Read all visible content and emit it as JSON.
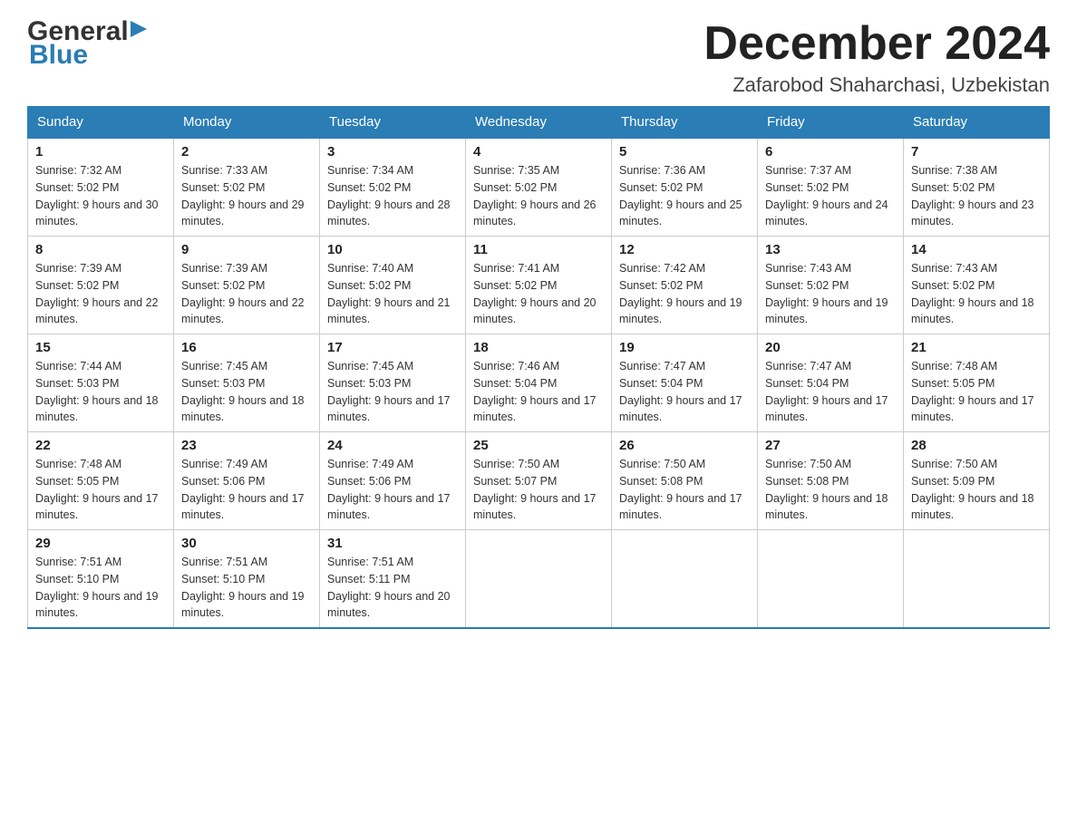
{
  "header": {
    "logo_general": "General",
    "logo_blue": "Blue",
    "month_title": "December 2024",
    "location": "Zafarobod Shaharchasi, Uzbekistan"
  },
  "days_of_week": [
    "Sunday",
    "Monday",
    "Tuesday",
    "Wednesday",
    "Thursday",
    "Friday",
    "Saturday"
  ],
  "weeks": [
    [
      {
        "day": "1",
        "sunrise": "7:32 AM",
        "sunset": "5:02 PM",
        "daylight": "9 hours and 30 minutes."
      },
      {
        "day": "2",
        "sunrise": "7:33 AM",
        "sunset": "5:02 PM",
        "daylight": "9 hours and 29 minutes."
      },
      {
        "day": "3",
        "sunrise": "7:34 AM",
        "sunset": "5:02 PM",
        "daylight": "9 hours and 28 minutes."
      },
      {
        "day": "4",
        "sunrise": "7:35 AM",
        "sunset": "5:02 PM",
        "daylight": "9 hours and 26 minutes."
      },
      {
        "day": "5",
        "sunrise": "7:36 AM",
        "sunset": "5:02 PM",
        "daylight": "9 hours and 25 minutes."
      },
      {
        "day": "6",
        "sunrise": "7:37 AM",
        "sunset": "5:02 PM",
        "daylight": "9 hours and 24 minutes."
      },
      {
        "day": "7",
        "sunrise": "7:38 AM",
        "sunset": "5:02 PM",
        "daylight": "9 hours and 23 minutes."
      }
    ],
    [
      {
        "day": "8",
        "sunrise": "7:39 AM",
        "sunset": "5:02 PM",
        "daylight": "9 hours and 22 minutes."
      },
      {
        "day": "9",
        "sunrise": "7:39 AM",
        "sunset": "5:02 PM",
        "daylight": "9 hours and 22 minutes."
      },
      {
        "day": "10",
        "sunrise": "7:40 AM",
        "sunset": "5:02 PM",
        "daylight": "9 hours and 21 minutes."
      },
      {
        "day": "11",
        "sunrise": "7:41 AM",
        "sunset": "5:02 PM",
        "daylight": "9 hours and 20 minutes."
      },
      {
        "day": "12",
        "sunrise": "7:42 AM",
        "sunset": "5:02 PM",
        "daylight": "9 hours and 19 minutes."
      },
      {
        "day": "13",
        "sunrise": "7:43 AM",
        "sunset": "5:02 PM",
        "daylight": "9 hours and 19 minutes."
      },
      {
        "day": "14",
        "sunrise": "7:43 AM",
        "sunset": "5:02 PM",
        "daylight": "9 hours and 18 minutes."
      }
    ],
    [
      {
        "day": "15",
        "sunrise": "7:44 AM",
        "sunset": "5:03 PM",
        "daylight": "9 hours and 18 minutes."
      },
      {
        "day": "16",
        "sunrise": "7:45 AM",
        "sunset": "5:03 PM",
        "daylight": "9 hours and 18 minutes."
      },
      {
        "day": "17",
        "sunrise": "7:45 AM",
        "sunset": "5:03 PM",
        "daylight": "9 hours and 17 minutes."
      },
      {
        "day": "18",
        "sunrise": "7:46 AM",
        "sunset": "5:04 PM",
        "daylight": "9 hours and 17 minutes."
      },
      {
        "day": "19",
        "sunrise": "7:47 AM",
        "sunset": "5:04 PM",
        "daylight": "9 hours and 17 minutes."
      },
      {
        "day": "20",
        "sunrise": "7:47 AM",
        "sunset": "5:04 PM",
        "daylight": "9 hours and 17 minutes."
      },
      {
        "day": "21",
        "sunrise": "7:48 AM",
        "sunset": "5:05 PM",
        "daylight": "9 hours and 17 minutes."
      }
    ],
    [
      {
        "day": "22",
        "sunrise": "7:48 AM",
        "sunset": "5:05 PM",
        "daylight": "9 hours and 17 minutes."
      },
      {
        "day": "23",
        "sunrise": "7:49 AM",
        "sunset": "5:06 PM",
        "daylight": "9 hours and 17 minutes."
      },
      {
        "day": "24",
        "sunrise": "7:49 AM",
        "sunset": "5:06 PM",
        "daylight": "9 hours and 17 minutes."
      },
      {
        "day": "25",
        "sunrise": "7:50 AM",
        "sunset": "5:07 PM",
        "daylight": "9 hours and 17 minutes."
      },
      {
        "day": "26",
        "sunrise": "7:50 AM",
        "sunset": "5:08 PM",
        "daylight": "9 hours and 17 minutes."
      },
      {
        "day": "27",
        "sunrise": "7:50 AM",
        "sunset": "5:08 PM",
        "daylight": "9 hours and 18 minutes."
      },
      {
        "day": "28",
        "sunrise": "7:50 AM",
        "sunset": "5:09 PM",
        "daylight": "9 hours and 18 minutes."
      }
    ],
    [
      {
        "day": "29",
        "sunrise": "7:51 AM",
        "sunset": "5:10 PM",
        "daylight": "9 hours and 19 minutes."
      },
      {
        "day": "30",
        "sunrise": "7:51 AM",
        "sunset": "5:10 PM",
        "daylight": "9 hours and 19 minutes."
      },
      {
        "day": "31",
        "sunrise": "7:51 AM",
        "sunset": "5:11 PM",
        "daylight": "9 hours and 20 minutes."
      },
      null,
      null,
      null,
      null
    ]
  ],
  "labels": {
    "sunrise": "Sunrise:",
    "sunset": "Sunset:",
    "daylight": "Daylight:"
  }
}
